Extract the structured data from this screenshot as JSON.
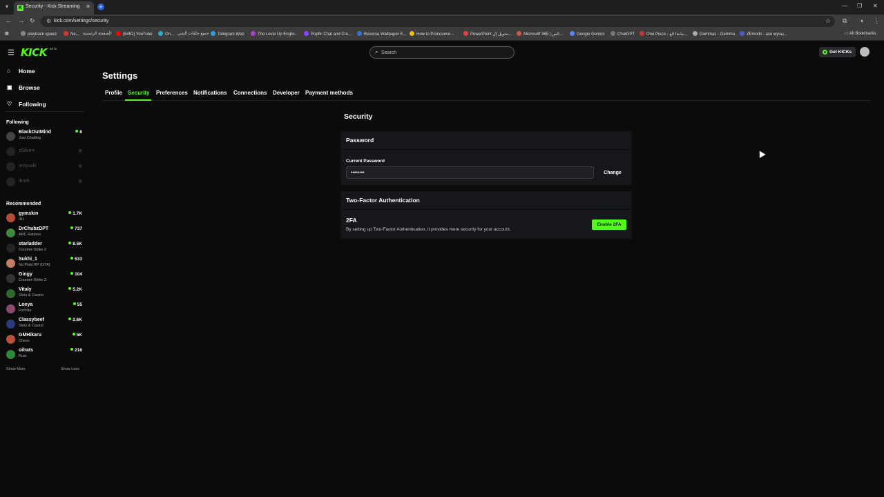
{
  "browser": {
    "tab_title": "Security - Kick Streaming",
    "tab_close": "✕",
    "new_tab": "+",
    "url": "kick.com/settings/security",
    "bookmarks": [
      "playback speed",
      "Ne...",
      "الصفحة الرئيسية",
      "(6452) YouTube",
      "On...",
      "جميع حلقات الشي",
      "Telegram Web",
      "The Level Up Englis...",
      "Popfic Chat and Cre...",
      "Reverse Wallpaper E...",
      "How to Pronounce...",
      "PowerPoint تحويل إل...",
      "Microsoft 365 | الص...",
      "Google Gemini",
      "ChatGPT",
      "One Piece - مانجا الع...",
      "Gammas - Gamma",
      "ZEmods - ace мучы..."
    ],
    "all_bookmarks": "All Bookmarks"
  },
  "header": {
    "logo": "KICK",
    "logo_badge": "BETA",
    "search_placeholder": "Search",
    "get_kicks": "Get KICKs"
  },
  "sidebar": {
    "nav": [
      {
        "label": "Home",
        "icon": "home-icon"
      },
      {
        "label": "Browse",
        "icon": "browse-icon"
      },
      {
        "label": "Following",
        "icon": "heart-icon"
      }
    ],
    "following_heading": "Following",
    "following": [
      {
        "name": "BlackOutMind",
        "category": "Just Chatting",
        "viewers": "6",
        "live": true
      },
      {
        "name": "zSilverr",
        "live": false
      },
      {
        "name": "imryuzki",
        "live": false
      },
      {
        "name": "itruth",
        "live": false
      }
    ],
    "recommended_heading": "Recommended",
    "recommended": [
      {
        "name": "gymskin",
        "category": "IRL",
        "viewers": "1.7K",
        "color": "#b84c3c"
      },
      {
        "name": "DrChubzDPT",
        "category": "ARC Raiders",
        "viewers": "737",
        "color": "#3c8a3c"
      },
      {
        "name": "starladder",
        "category": "Counter-Strike 2",
        "viewers": "8.5K",
        "color": "#222222"
      },
      {
        "name": "Sukhi_1",
        "category": "No Pixel RP (GTA)",
        "viewers": "533",
        "color": "#c08060"
      },
      {
        "name": "Gingy",
        "category": "Counter-Strike 2",
        "viewers": "104",
        "color": "#333333"
      },
      {
        "name": "Vitaly",
        "category": "Slots & Casino",
        "viewers": "5.2K",
        "color": "#2a6a2a"
      },
      {
        "name": "Loeya",
        "category": "Fortnite",
        "viewers": "55",
        "color": "#8a4a6a"
      },
      {
        "name": "Classybeef",
        "category": "Slots & Casino",
        "viewers": "2.6K",
        "color": "#2a3a7a"
      },
      {
        "name": "GMHikaru",
        "category": "Chess",
        "viewers": "5K",
        "color": "#b8503a"
      },
      {
        "name": "oilrats",
        "category": "Rust",
        "viewers": "216",
        "color": "#2a8a3a"
      }
    ],
    "show_more": "Show More",
    "show_less": "Show Less"
  },
  "settings": {
    "title": "Settings",
    "tabs": [
      "Profile",
      "Security",
      "Preferences",
      "Notifications",
      "Connections",
      "Developer",
      "Payment methods"
    ],
    "active_tab": "Security",
    "section_title": "Security",
    "password_card": {
      "title": "Password",
      "field_label": "Current Password",
      "value": "••••••••",
      "change_label": "Change"
    },
    "tfa_card": {
      "title": "Two-Factor Authentication",
      "label": "2FA",
      "description": "By setting up Two-Factor Authentication, it provides more security for your account.",
      "button": "Enable 2FA"
    }
  },
  "colors": {
    "accent": "#53fc18",
    "background": "#0b0b0c",
    "card": "#16171a"
  }
}
